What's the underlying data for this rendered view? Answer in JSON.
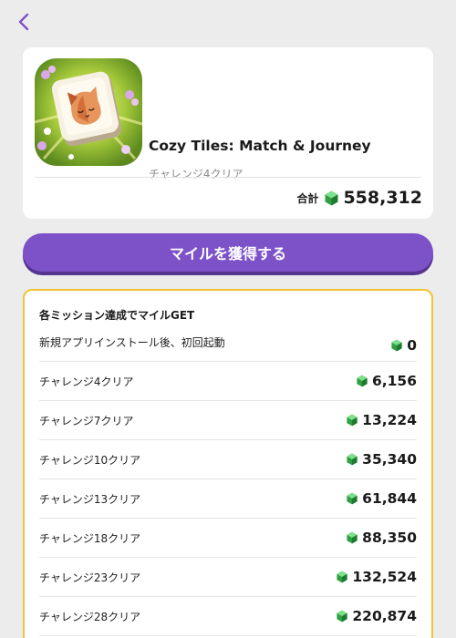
{
  "nav": {
    "back_icon": "chevron-left-icon",
    "accent_color": "#7d52c9"
  },
  "app": {
    "title": "Cozy Tiles: Match & Journey",
    "subtitle": "チャレンジ4クリア",
    "icon": "cat-tile-app-icon",
    "total_label": "合計",
    "total_value": "558,312",
    "currency_icon": "green-gem-icon"
  },
  "cta": {
    "label": "マイルを獲得する",
    "color": "#7d52c9"
  },
  "missions": {
    "header": "各ミッション達成でマイルGET",
    "border_color": "#f2c232",
    "items": [
      {
        "label": "新規アプリインストール後、初回起動",
        "value": "0"
      },
      {
        "label": "チャレンジ4クリア",
        "value": "6,156"
      },
      {
        "label": "チャレンジ7クリア",
        "value": "13,224"
      },
      {
        "label": "チャレンジ10クリア",
        "value": "35,340"
      },
      {
        "label": "チャレンジ13クリア",
        "value": "61,844"
      },
      {
        "label": "チャレンジ18クリア",
        "value": "88,350"
      },
      {
        "label": "チャレンジ23クリア",
        "value": "132,524"
      },
      {
        "label": "チャレンジ28クリア",
        "value": "220,874"
      }
    ]
  }
}
